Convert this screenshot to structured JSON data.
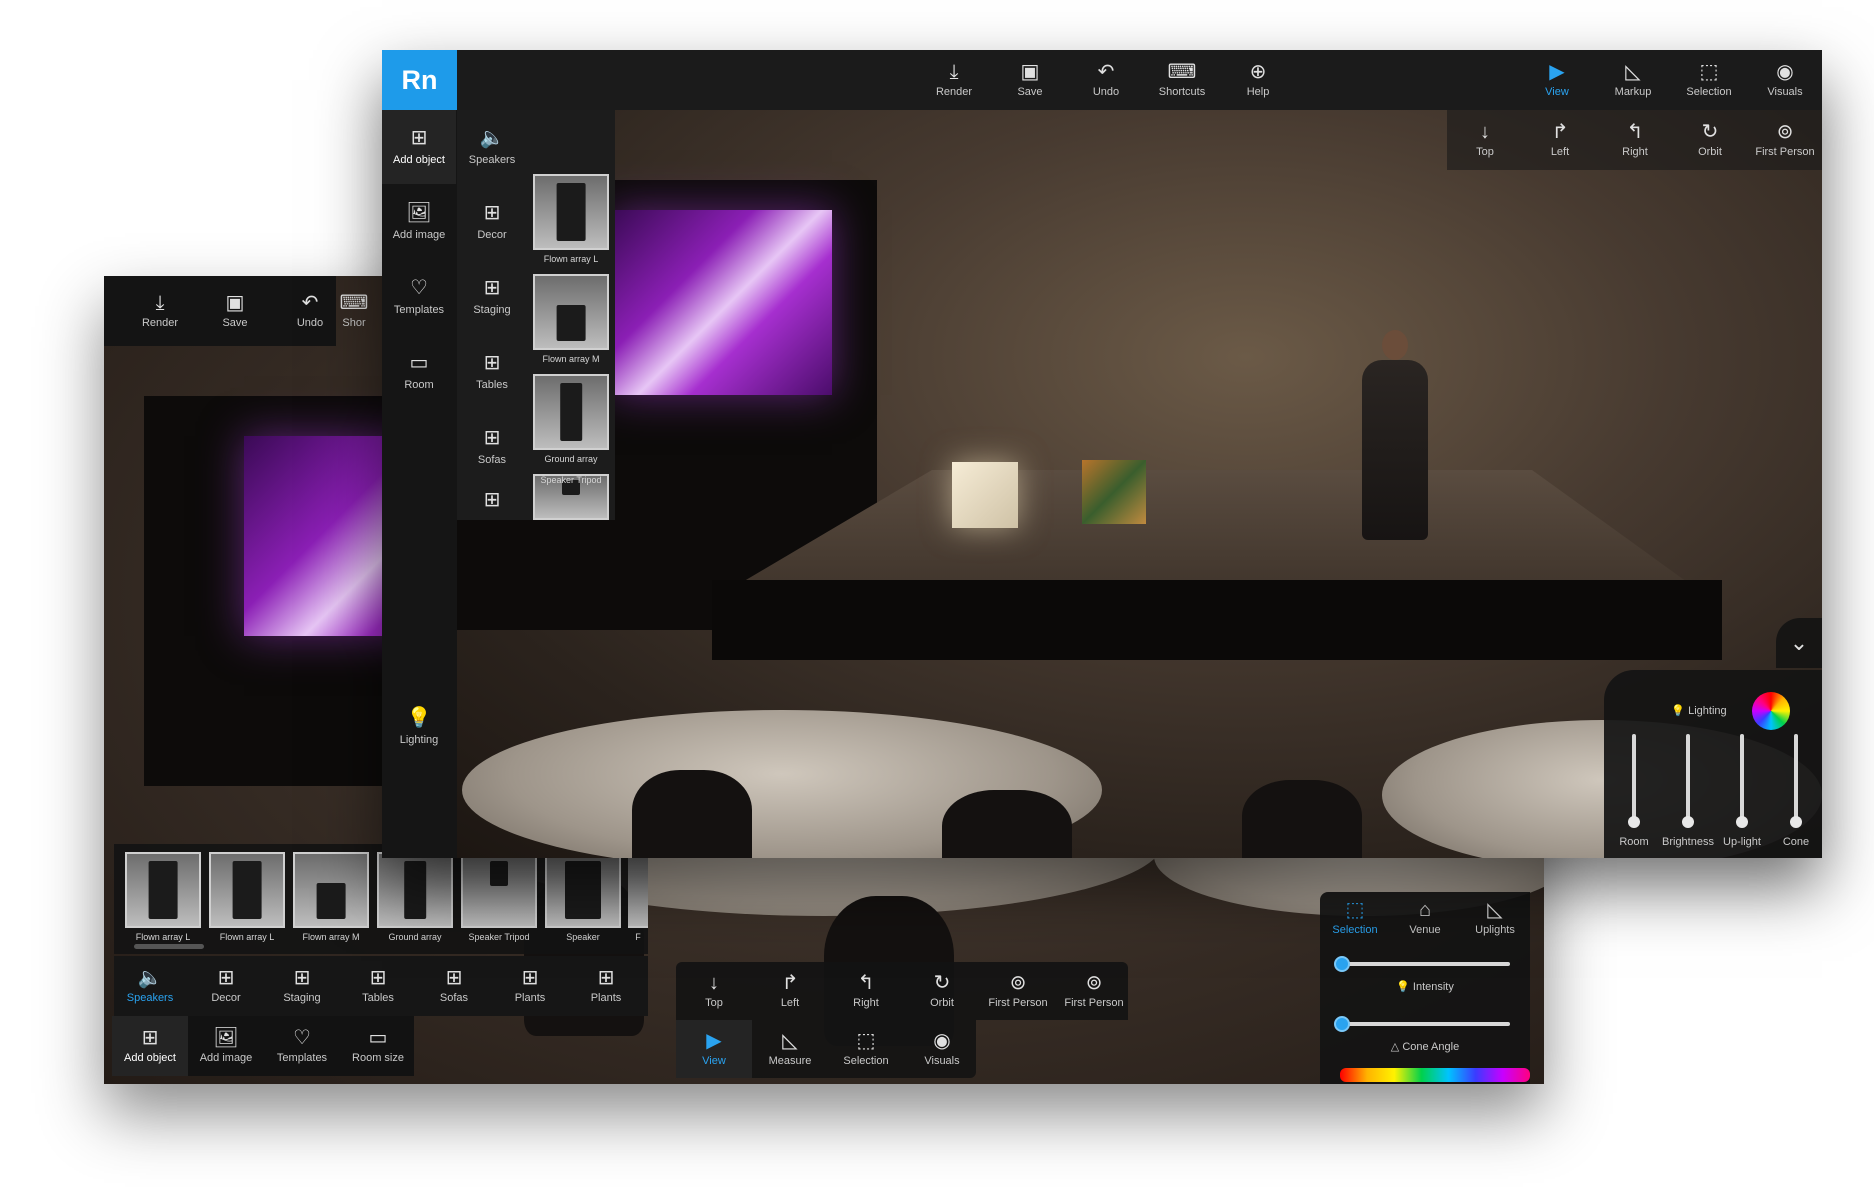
{
  "front": {
    "logo": "Rn",
    "toolbar": [
      {
        "label": "Render",
        "icon": "download-icon"
      },
      {
        "label": "Save",
        "icon": "save-icon"
      },
      {
        "label": "Undo",
        "icon": "undo-icon"
      },
      {
        "label": "Shortcuts",
        "icon": "keyboard-icon"
      },
      {
        "label": "Help",
        "icon": "help-lifebuoy-icon"
      }
    ],
    "view_modes": [
      {
        "label": "View",
        "icon": "camera-icon",
        "active": true
      },
      {
        "label": "Markup",
        "icon": "ruler-triangle-icon"
      },
      {
        "label": "Selection",
        "icon": "selection-box-icon"
      },
      {
        "label": "Visuals",
        "icon": "eye-icon"
      }
    ],
    "camera_modes": [
      {
        "label": "Top",
        "icon": "arrow-down-icon"
      },
      {
        "label": "Left",
        "icon": "turn-left-icon"
      },
      {
        "label": "Right",
        "icon": "turn-right-icon"
      },
      {
        "label": "Orbit",
        "icon": "orbit-icon"
      },
      {
        "label": "First Person",
        "icon": "first-person-icon"
      }
    ],
    "sidebar": [
      {
        "label": "Add object",
        "icon": "add-object-icon",
        "active": true
      },
      {
        "label": "Add image",
        "icon": "add-image-icon"
      },
      {
        "label": "Templates",
        "icon": "heart-plus-icon"
      },
      {
        "label": "Room",
        "icon": "room-icon"
      },
      {
        "label": "Lighting",
        "icon": "lightbulb-icon"
      }
    ],
    "categories": [
      "Speakers",
      "Decor",
      "Staging",
      "Tables",
      "Sofas"
    ],
    "thumbnails": [
      "Flown array L",
      "Flown array M",
      "Ground array",
      "Speaker Tripod"
    ],
    "lighting_panel": {
      "title": "Lighting",
      "sliders": [
        "Room",
        "Brightness",
        "Up-light",
        "Cone"
      ]
    }
  },
  "back": {
    "toolbar": [
      {
        "label": "Render",
        "icon": "download-icon"
      },
      {
        "label": "Save",
        "icon": "save-icon"
      },
      {
        "label": "Undo",
        "icon": "undo-icon"
      },
      {
        "label": "Shor",
        "icon": "keyboard-icon"
      }
    ],
    "thumbnails": [
      "Flown array L",
      "Flown array L",
      "Flown array M",
      "Ground array",
      "Speaker Tripod",
      "Speaker",
      "F"
    ],
    "categories": [
      {
        "label": "Speakers",
        "icon": "speaker-icon",
        "active": true
      },
      {
        "label": "Decor",
        "icon": "grid-plus-icon"
      },
      {
        "label": "Staging",
        "icon": "grid-plus-icon"
      },
      {
        "label": "Tables",
        "icon": "grid-plus-icon"
      },
      {
        "label": "Sofas",
        "icon": "grid-plus-icon"
      },
      {
        "label": "Plants",
        "icon": "grid-plus-icon"
      },
      {
        "label": "Plants",
        "icon": "grid-plus-icon"
      }
    ],
    "bottom_actions": [
      {
        "label": "Add object",
        "icon": "add-object-icon",
        "active": true
      },
      {
        "label": "Add image",
        "icon": "add-image-icon"
      },
      {
        "label": "Templates",
        "icon": "heart-plus-icon"
      },
      {
        "label": "Room size",
        "icon": "room-icon"
      }
    ],
    "camera_modes": [
      {
        "label": "Top",
        "icon": "arrow-down-icon"
      },
      {
        "label": "Left",
        "icon": "turn-left-icon"
      },
      {
        "label": "Right",
        "icon": "turn-right-icon"
      },
      {
        "label": "Orbit",
        "icon": "orbit-icon"
      },
      {
        "label": "First Person",
        "icon": "first-person-icon"
      },
      {
        "label": "First Person",
        "icon": "first-person-icon"
      }
    ],
    "view_modes": [
      {
        "label": "View",
        "icon": "camera-icon",
        "active": true
      },
      {
        "label": "Measure",
        "icon": "ruler-triangle-icon"
      },
      {
        "label": "Selection",
        "icon": "selection-box-icon"
      },
      {
        "label": "Visuals",
        "icon": "eye-icon"
      }
    ],
    "lighting_panel": {
      "tabs": [
        {
          "label": "Selection",
          "icon": "selection-box-icon",
          "active": true
        },
        {
          "label": "Venue",
          "icon": "venue-icon"
        },
        {
          "label": "Uplights",
          "icon": "uplight-icon"
        }
      ],
      "intensity_label": "Intensity",
      "cone_angle_label": "Cone Angle"
    }
  }
}
